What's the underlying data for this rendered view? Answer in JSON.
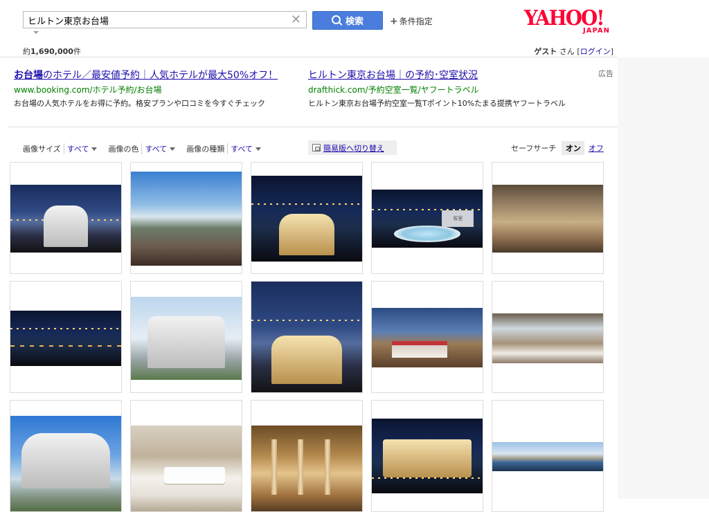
{
  "search": {
    "query": "ヒルトン東京お台場",
    "button_label": "検索",
    "conditions_label": "条件指定"
  },
  "logo": {
    "main": "YAHOO!",
    "sub": "JAPAN"
  },
  "result_count": {
    "prefix": "約",
    "number": "1,690,000",
    "suffix": "件"
  },
  "user": {
    "name": "ゲスト",
    "honorific": "さん",
    "bracket_open": "[",
    "login": "ログイン",
    "bracket_close": "]"
  },
  "ads": {
    "label": "広告",
    "items": [
      {
        "title_bold": "お台場",
        "title_rest": "のホテル／最安値予約｜人気ホテルが最大50%オフ！",
        "url": "www.booking.com/ホテル予約/お台場",
        "desc": "お台場の人気ホテルをお得に予約。格安プランや口コミを今すぐチェック"
      },
      {
        "title_bold": "ヒルトン東京お台場",
        "title_rest": "｜の予約･空室状況",
        "url": "drafthick.com/予約空室一覧/ヤフートラベル",
        "desc": "ヒルトン東京お台場予約空室一覧Tポイント10%たまる提携ヤフートラベル"
      }
    ]
  },
  "filters": [
    {
      "label": "画像サイズ",
      "value": "すべて"
    },
    {
      "label": "画像の色",
      "value": "すべて"
    },
    {
      "label": "画像の種類",
      "value": "すべて"
    }
  ],
  "simple_view_label": "簡易版へ切り替え",
  "safesearch": {
    "label": "セーフサーチ",
    "on": "オン",
    "off": "オフ"
  },
  "images": [
    {
      "scene": "hotel-bay-skyline"
    },
    {
      "scene": "terrace-rainbow-bridge"
    },
    {
      "scene": "hotel-night-bay"
    },
    {
      "scene": "jacuzzi-night-view"
    },
    {
      "scene": "restaurant-interior"
    },
    {
      "scene": "night-bridge-lounge"
    },
    {
      "scene": "hotel-exterior-day"
    },
    {
      "scene": "hotel-dusk-aerial"
    },
    {
      "scene": "bathtub-rose-petals"
    },
    {
      "scene": "dining-room-window"
    },
    {
      "scene": "hotel-exterior-blue-sky"
    },
    {
      "scene": "hotel-bedroom"
    },
    {
      "scene": "lobby-chandelier"
    },
    {
      "scene": "hotel-night-entrance"
    },
    {
      "scene": "bay-panorama"
    }
  ]
}
